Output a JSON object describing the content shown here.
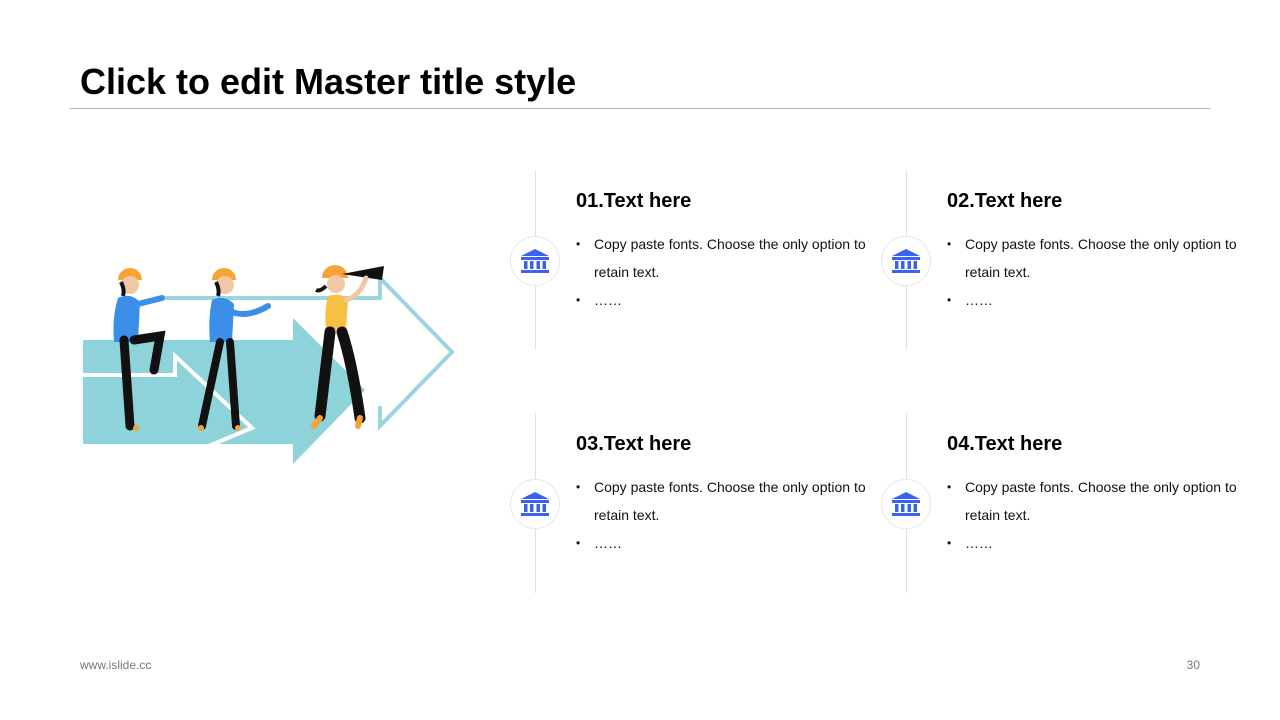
{
  "title": "Click to edit Master title style",
  "colors": {
    "accent_blue": "#3a62f0",
    "arrow_teal": "#8fd3da",
    "arrow_outline": "#9ad6dc",
    "helmet_orange": "#f7a233",
    "shirt_blue": "#3b8fe8",
    "shirt_yellow": "#f6c042"
  },
  "cards": [
    {
      "title": "01.Text here",
      "icon": "bank-icon",
      "bullets": [
        "Copy paste fonts. Choose the only option to retain text.",
        "……"
      ]
    },
    {
      "title": "02.Text here",
      "icon": "bank-icon",
      "bullets": [
        "Copy paste fonts. Choose the only option to retain text.",
        "……"
      ]
    },
    {
      "title": "03.Text here",
      "icon": "bank-icon",
      "bullets": [
        "Copy paste fonts. Choose the only option to retain text.",
        "……"
      ]
    },
    {
      "title": "04.Text here",
      "icon": "bank-icon",
      "bullets": [
        "Copy paste fonts. Choose the only option to retain text.",
        "……"
      ]
    }
  ],
  "footer": {
    "url": "www.islide.cc",
    "page_number": "30"
  }
}
